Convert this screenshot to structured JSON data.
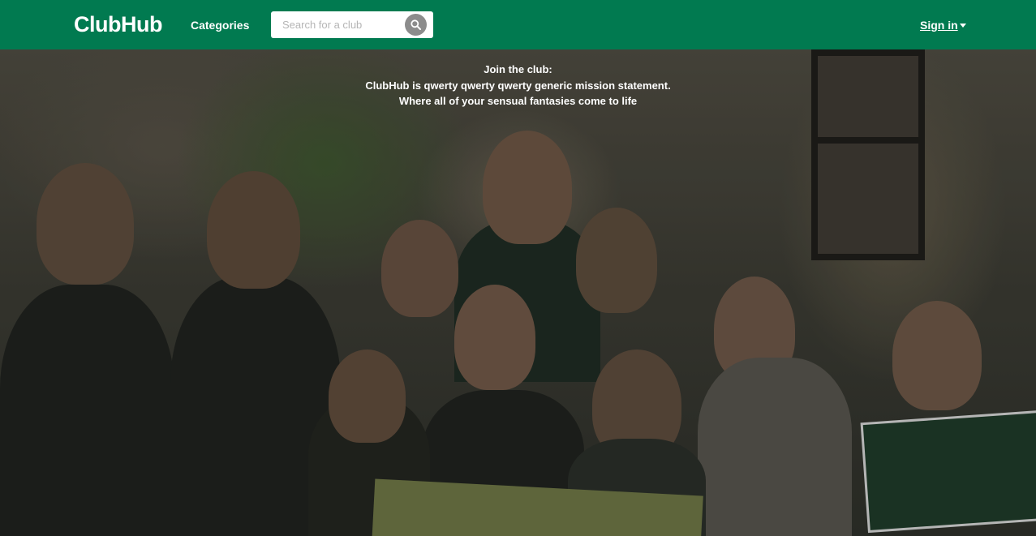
{
  "navbar": {
    "brand": "ClubHub",
    "categories_label": "Categories",
    "search": {
      "placeholder": "Search for a club",
      "value": ""
    },
    "search_icon": "search-icon",
    "signin_label": "Sign in",
    "signin_icon": "caret-down-icon"
  },
  "hero": {
    "line1": "Join the club:",
    "line2": "ClubHub is qwerty qwerty qwerty generic mission statement.",
    "line3": "Where all of your sensual fantasies come to life"
  },
  "colors": {
    "navbar": "#017a50",
    "text": "#ffffff",
    "search_button": "#8c8c8c"
  }
}
